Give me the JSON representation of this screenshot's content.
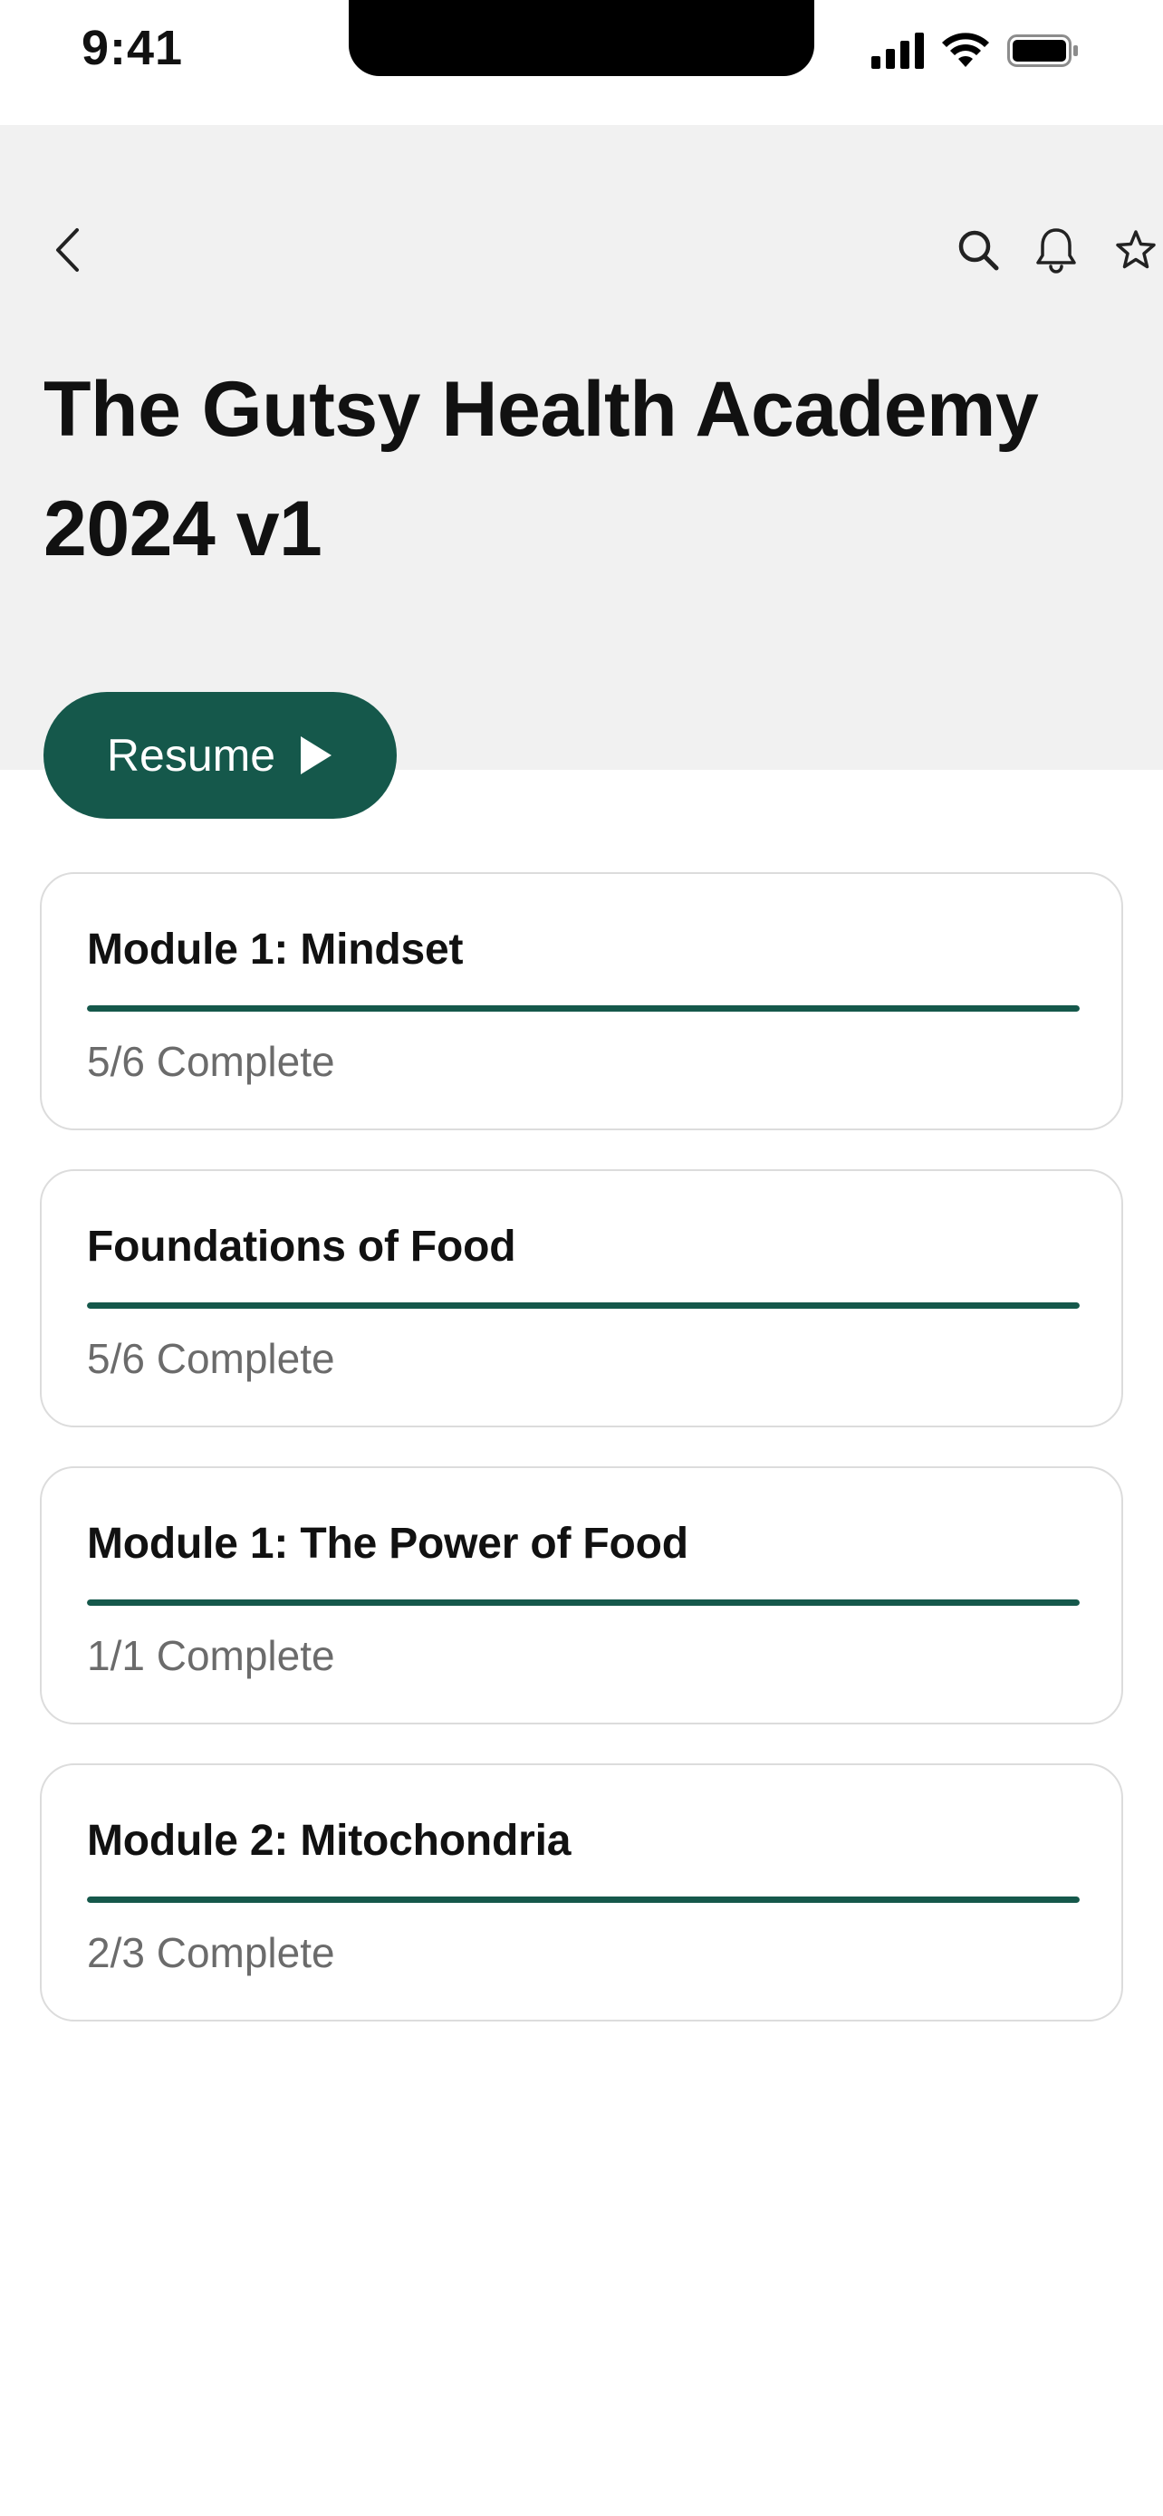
{
  "status_bar": {
    "time": "9:41"
  },
  "header": {
    "title": "The Gutsy Health Academy 2024 v1",
    "back_icon": "chevron-left-icon",
    "actions": [
      "search-icon",
      "bell-icon",
      "star-icon"
    ]
  },
  "resume": {
    "label": "Resume",
    "icon": "play-icon"
  },
  "modules": [
    {
      "title": "Module 1: Mindset",
      "status": "5/6 Complete",
      "progress": 1.0
    },
    {
      "title": "Foundations of Food",
      "status": "5/6 Complete",
      "progress": 1.0
    },
    {
      "title": "Module 1: The Power of Food",
      "status": "1/1 Complete",
      "progress": 1.0
    },
    {
      "title": "Module 2: Mitochondria",
      "status": "2/3 Complete",
      "progress": 1.0
    }
  ],
  "colors": {
    "accent": "#15584b",
    "header_bg": "#f1f1f1",
    "muted_text": "#6b6b6b",
    "card_border": "#dcdcdc"
  }
}
